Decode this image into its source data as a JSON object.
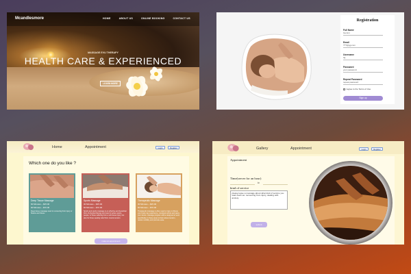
{
  "hero": {
    "brand": "Mcandlesmore",
    "nav": [
      "HOME",
      "ABOUT US",
      "ONLINE BOOKING",
      "CONTACT US"
    ],
    "eyebrow": "MASSAGE EVU THERAPY",
    "headline": "HEALTH CARE & EXPERIENCED",
    "cta": "LEARN MORE"
  },
  "registration": {
    "title": "Registration",
    "fields": [
      {
        "label": "Full Name",
        "value": "Gemini"
      },
      {
        "label": "Email",
        "value": "???@gg.com"
      },
      {
        "label": "Username",
        "value": "ttg"
      },
      {
        "label": "Password",
        "value": "your password"
      },
      {
        "label": "Repeat Password",
        "value": "repeat password"
      }
    ],
    "terms": "I agree to the Terms of Use",
    "submit": "Sign up"
  },
  "services": {
    "nav": {
      "home": "Home",
      "appointment": "Appointment",
      "login": "Login",
      "register": "Register"
    },
    "question": "Which one do you like ?",
    "cards": [
      {
        "title": "Deep Tissue Massage",
        "lines": [
          "60 Minutes – $45.00",
          "90 Minutes – $70.00"
        ],
        "desc": "Deep tissue massage used in recovering from injury or Strains and Stress",
        "bg": "#5f9c97"
      },
      {
        "title": "Sports Massage",
        "lines": [
          "30 Minutes – $45.00",
          "60 Minutes – $70.00"
        ],
        "desc": "Sports and sports massage is an effective and beneficial form of physical therapy and care for active sports, people, or those suffering from a soft tissue injury, but also for those seeking relief from muscle tension.",
        "bg": "#c65f57"
      },
      {
        "title": "Therapeutic Massage",
        "lines": [
          "30 Minutes – $45.00",
          "60 Minutes – $70.00"
        ],
        "desc": "Therapeutic massage is often used to injury or illness your body may experience, consistent aches and pains, your stress. massage program will be designed to work specifically on those areas to help relieve tension, restore mobility, and promote ease.",
        "bg": "#d7a15f"
      }
    ],
    "book": "make an appointment"
  },
  "appointment": {
    "nav": {
      "gallery": "Gallery",
      "appointment": "Appointment",
      "login": "Login",
      "register": "Register"
    },
    "heading": "Appointment",
    "time_label": "Time(server for an hour)",
    "to": "to",
    "kind_label": "kind of service",
    "textarea": "please leave a message about what kind of service you want.Such as: recovering from injury, dealing with anxiety.",
    "submit": "submit"
  },
  "colors": {
    "accent": "#a08bd3",
    "panel_cream": "#fdf7cf"
  }
}
